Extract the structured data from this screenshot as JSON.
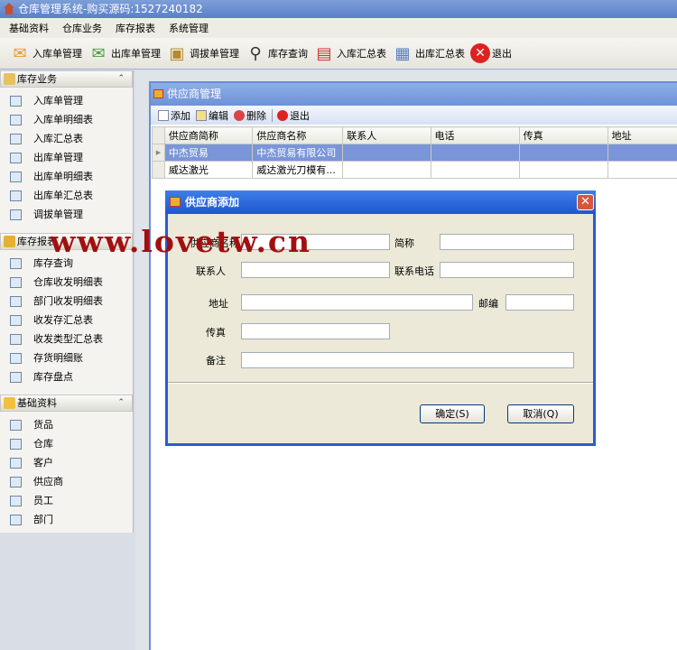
{
  "app": {
    "title": "仓库管理系统-购买源码:1527240182"
  },
  "menu": [
    "基础资料",
    "仓库业务",
    "库存报表",
    "系统管理"
  ],
  "toolbar": [
    {
      "label": "入库单管理",
      "icon": "stock-in-icon"
    },
    {
      "label": "出库单管理",
      "icon": "stock-out-icon"
    },
    {
      "label": "调拔单管理",
      "icon": "transfer-icon"
    },
    {
      "label": "库存查询",
      "icon": "search-icon"
    },
    {
      "label": "入库汇总表",
      "icon": "calendar-icon"
    },
    {
      "label": "出库汇总表",
      "icon": "table-icon"
    },
    {
      "label": "退出",
      "icon": "close-icon"
    }
  ],
  "sidebar": {
    "groups": [
      {
        "title": "库存业务",
        "items": [
          "入库单管理",
          "入库单明细表",
          "入库汇总表",
          "出库单管理",
          "出库单明细表",
          "出库单汇总表",
          "调拔单管理"
        ]
      },
      {
        "title": "库存报表",
        "items": [
          "库存查询",
          "仓库收发明细表",
          "部门收发明细表",
          "收发存汇总表",
          "收发类型汇总表",
          "存货明细账",
          "库存盘点"
        ]
      },
      {
        "title": "基础资料",
        "items": [
          "货品",
          "仓库",
          "客户",
          "供应商",
          "员工",
          "部门"
        ]
      }
    ]
  },
  "supplier_window": {
    "title": "供应商管理",
    "tools": {
      "add": "添加",
      "edit": "编辑",
      "delete": "删除",
      "exit": "退出"
    },
    "columns": [
      "供应商简称",
      "供应商名称",
      "联系人",
      "电话",
      "传真",
      "地址"
    ],
    "rows": [
      [
        "中杰贸易",
        "中杰贸易有限公司",
        "",
        "",
        "",
        ""
      ],
      [
        "威达激光",
        "威达激光刀模有...",
        "",
        "",
        "",
        ""
      ]
    ]
  },
  "dialog": {
    "title": "供应商添加",
    "close": "✕",
    "labels": {
      "name": "供应商名称",
      "short": "简称",
      "contact": "联系人",
      "phone": "联系电话",
      "address": "地址",
      "zip": "邮编",
      "fax": "传真",
      "note": "备注"
    },
    "values": {
      "name": "",
      "short": "",
      "contact": "",
      "phone": "",
      "address": "",
      "zip": "",
      "fax": "",
      "note": ""
    },
    "ok": "确定(S)",
    "cancel": "取消(Q)"
  },
  "watermark": "www.lovetw.cn"
}
